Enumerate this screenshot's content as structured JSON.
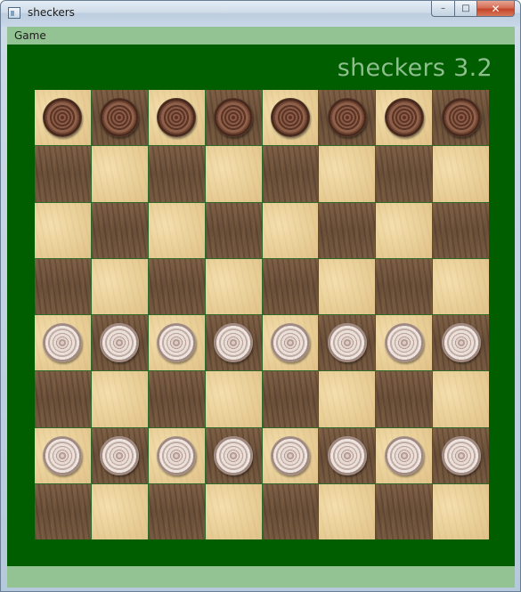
{
  "window": {
    "title": "sheckers",
    "controls": {
      "minimize": "–",
      "maximize": "□",
      "close": "✕"
    }
  },
  "menu": {
    "items": [
      {
        "label": "Game"
      }
    ]
  },
  "game": {
    "title": "sheckers 3.2"
  },
  "colors": {
    "background": "#005d00",
    "bars": "#93c293",
    "title_text": "#8cbf8c"
  },
  "board": {
    "size": 8,
    "top_left_square": "light",
    "pieces": [
      [
        "dark",
        "dark",
        "dark",
        "dark",
        "dark",
        "dark",
        "dark",
        "dark"
      ],
      [
        "",
        "",
        "",
        "",
        "",
        "",
        "",
        ""
      ],
      [
        "",
        "",
        "",
        "",
        "",
        "",
        "",
        ""
      ],
      [
        "",
        "",
        "",
        "",
        "",
        "",
        "",
        ""
      ],
      [
        "light",
        "light",
        "light",
        "light",
        "light",
        "light",
        "light",
        "light"
      ],
      [
        "",
        "",
        "",
        "",
        "",
        "",
        "",
        ""
      ],
      [
        "light",
        "light",
        "light",
        "light",
        "light",
        "light",
        "light",
        "light"
      ],
      [
        "",
        "",
        "",
        "",
        "",
        "",
        "",
        ""
      ]
    ]
  }
}
